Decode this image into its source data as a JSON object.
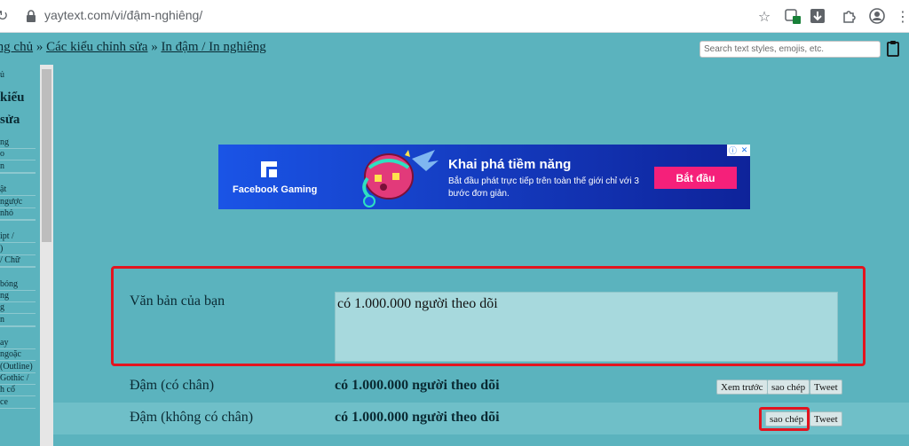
{
  "browser": {
    "url": "yaytext.com/vi/đậm-nghiêng/"
  },
  "header": {
    "breadcrumb": {
      "home": "ang chủ",
      "sep1": " » ",
      "edit_styles": "Các kiểu chỉnh sửa",
      "sep2": " » ",
      "current": "In đậm / In nghiêng"
    },
    "search_placeholder": "Search text styles, emojis, etc."
  },
  "sidebar": {
    "top": "ủ",
    "big1": "kiểu",
    "big2": "sửa",
    "items": [
      "ng",
      "o",
      "n",
      "",
      "ật",
      "ngược",
      "nhỏ",
      "",
      "ipt /",
      ")",
      "/ Chữ",
      "",
      "bóng",
      "ng",
      "g",
      "n",
      "",
      "ay",
      "ngoặc",
      "(Outline)",
      "Gothic /",
      "h cổ",
      "ce"
    ]
  },
  "ad": {
    "brand": "Facebook Gaming",
    "headline": "Khai phá tiềm năng",
    "subtext": "Bắt đầu phát trực tiếp trên toàn thế giới chỉ với 3 bước đơn giản.",
    "cta": "Bắt đầu"
  },
  "input_section": {
    "label": "Văn bản của bạn",
    "value": "có 1.000.000 người theo dõi"
  },
  "results": [
    {
      "label": "Đậm (có chân)",
      "value": "có 1.000.000 người theo dõi",
      "buttons": [
        "Xem trước",
        "sao chép",
        "Tweet"
      ]
    },
    {
      "label": "Đậm (không có chân)",
      "value": "có 1.000.000 người theo dõi",
      "buttons": [
        "sao chép",
        "Tweet"
      ]
    }
  ]
}
